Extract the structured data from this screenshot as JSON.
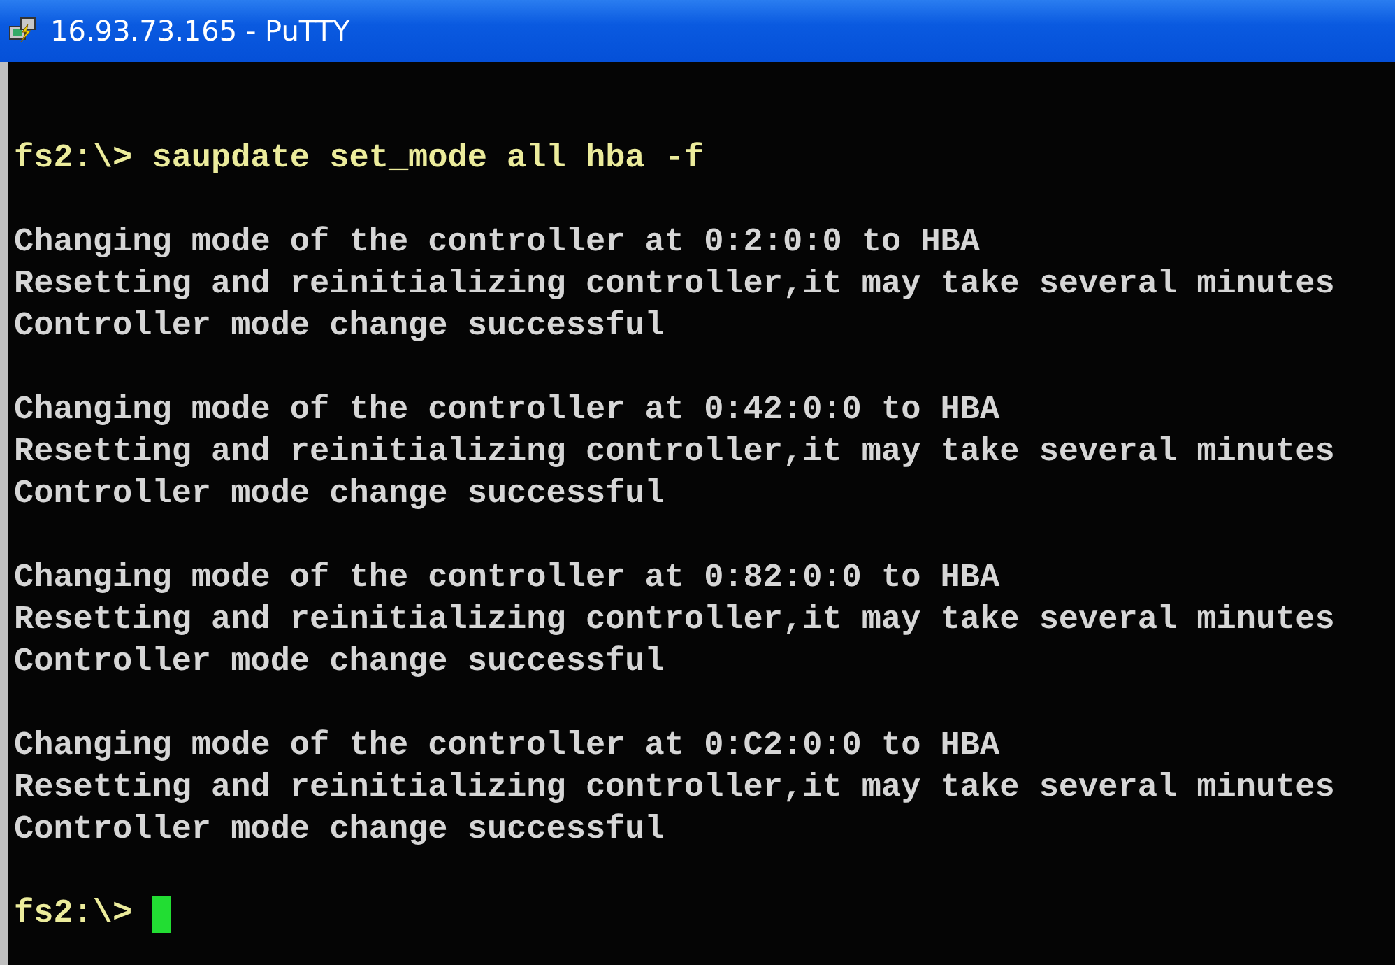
{
  "window": {
    "title": "16.93.73.165 - PuTTY"
  },
  "terminal": {
    "command_line": "fs2:\\> saupdate set_mode all hba -f",
    "output_blocks": [
      [
        "Changing mode of the controller at 0:2:0:0 to HBA",
        "Resetting and reinitializing controller,it may take several minutes",
        "Controller mode change successful"
      ],
      [
        "Changing mode of the controller at 0:42:0:0 to HBA",
        "Resetting and reinitializing controller,it may take several minutes",
        "Controller mode change successful"
      ],
      [
        "Changing mode of the controller at 0:82:0:0 to HBA",
        "Resetting and reinitializing controller,it may take several minutes",
        "Controller mode change successful"
      ],
      [
        "Changing mode of the controller at 0:C2:0:0 to HBA",
        "Resetting and reinitializing controller,it may take several minutes",
        "Controller mode change successful"
      ]
    ],
    "prompt": "fs2:\\>"
  }
}
